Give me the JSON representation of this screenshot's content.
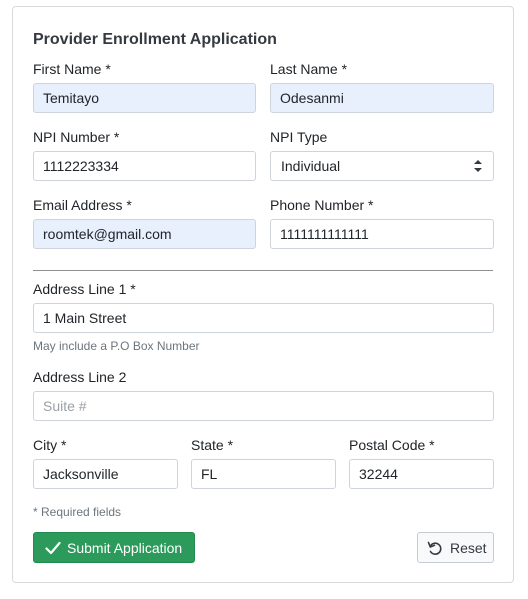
{
  "form": {
    "title": "Provider Enrollment Application",
    "first_name": {
      "label": "First Name *",
      "value": "Temitayo"
    },
    "last_name": {
      "label": "Last Name *",
      "value": "Odesanmi"
    },
    "npi_number": {
      "label": "NPI Number *",
      "value": "1112223334"
    },
    "npi_type": {
      "label": "NPI Type",
      "value": "Individual"
    },
    "email": {
      "label": "Email Address *",
      "value": "roomtek@gmail.com"
    },
    "phone": {
      "label": "Phone Number *",
      "value": "1111111111111"
    },
    "address1": {
      "label": "Address Line 1 *",
      "value": "1 Main Street",
      "help": "May include a P.O Box Number"
    },
    "address2": {
      "label": "Address Line 2",
      "value": "",
      "placeholder": "Suite #"
    },
    "city": {
      "label": "City *",
      "value": "Jacksonville"
    },
    "state": {
      "label": "State *",
      "value": "FL"
    },
    "postal_code": {
      "label": "Postal Code *",
      "value": "32244"
    },
    "required_note": "* Required fields",
    "submit_label": "Submit Application",
    "reset_label": "Reset"
  },
  "colors": {
    "submit_bg": "#2b9a5b",
    "autofill_bg": "#e8f0fe",
    "border": "#ced4da"
  },
  "icons": {
    "submit": "check-icon",
    "reset": "undo-icon",
    "select": "chevron-updown-icon"
  }
}
